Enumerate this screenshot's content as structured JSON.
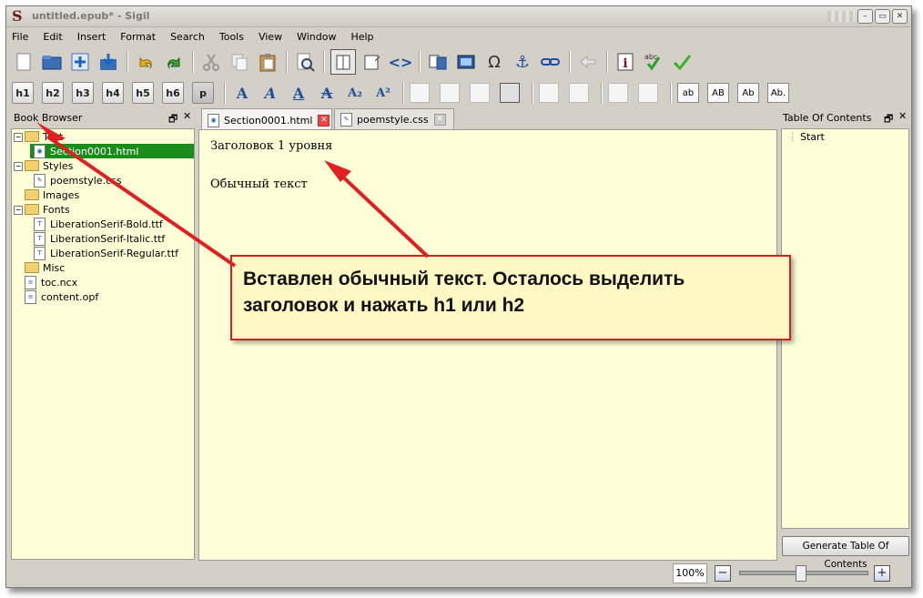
{
  "window": {
    "title": "untitled.epub* - Sigil",
    "app_icon": "S",
    "buttons": [
      "minimize",
      "maximize",
      "close"
    ]
  },
  "menu": [
    "File",
    "Edit",
    "Insert",
    "Format",
    "Search",
    "Tools",
    "View",
    "Window",
    "Help"
  ],
  "toolbar1": {
    "icons": [
      "new-file-icon",
      "open-folder-icon",
      "add-file-icon",
      "save-icon",
      "undo-icon",
      "redo-icon",
      "cut-icon",
      "copy-icon",
      "paste-icon",
      "find-icon",
      "book-view-icon",
      "code-split-icon",
      "code-view-icon",
      "toc-icon",
      "image-icon",
      "omega-icon",
      "anchor-icon",
      "link-icon",
      "back-icon",
      "info-icon",
      "spellcheck-icon",
      "validate-icon"
    ],
    "omega": "Ω",
    "info": "i",
    "spellcheck": "abc"
  },
  "toolbar2": {
    "headings": [
      "h1",
      "h2",
      "h3",
      "h4",
      "h5",
      "h6",
      "p"
    ],
    "format_glyphs": [
      "A",
      "A",
      "A",
      "A",
      "A₂",
      "A²"
    ],
    "case_buttons": [
      "ab",
      "AB",
      "Ab",
      "Ab."
    ]
  },
  "book_browser": {
    "title": "Book Browser",
    "tree": [
      {
        "label": "Text",
        "kind": "folder",
        "expanded": true
      },
      {
        "label": "Section0001.html",
        "kind": "file",
        "selected": true
      },
      {
        "label": "Styles",
        "kind": "folder",
        "expanded": true
      },
      {
        "label": "poemstyle.css",
        "kind": "file"
      },
      {
        "label": "Images",
        "kind": "folder"
      },
      {
        "label": "Fonts",
        "kind": "folder",
        "expanded": true
      },
      {
        "label": "LiberationSerif-Bold.ttf",
        "kind": "file"
      },
      {
        "label": "LiberationSerif-Italic.ttf",
        "kind": "file"
      },
      {
        "label": "LiberationSerif-Regular.ttf",
        "kind": "file"
      },
      {
        "label": "Misc",
        "kind": "folder"
      },
      {
        "label": "toc.ncx",
        "kind": "file"
      },
      {
        "label": "content.opf",
        "kind": "file"
      }
    ]
  },
  "tabs": [
    {
      "label": "Section0001.html",
      "active": true
    },
    {
      "label": "poemstyle.css",
      "active": false
    }
  ],
  "editor": {
    "heading": "Заголовок 1 уровня",
    "body": "Обычный текст"
  },
  "toc": {
    "title": "Table Of Contents",
    "items": [
      "Start"
    ],
    "generate_label": "Generate Table Of Contents"
  },
  "status": {
    "zoom": "100%",
    "zoom_out": "−",
    "zoom_in": "+"
  },
  "callout": {
    "text": "Вставлен обычный текст. Осталось выделить заголовок и нажать h1 или h2",
    "border_color": "#d42020"
  }
}
